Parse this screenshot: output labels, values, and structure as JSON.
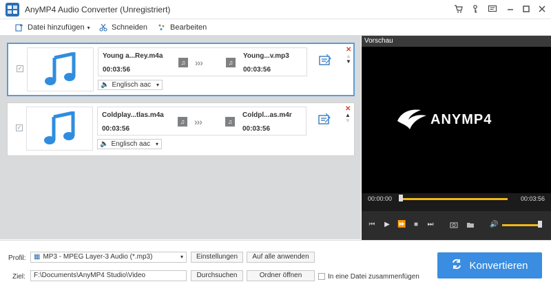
{
  "titlebar": {
    "title": "AnyMP4 Audio Converter (Unregistriert)",
    "buttons": [
      "cart-icon",
      "key-icon",
      "feedback-icon",
      "minimize-icon",
      "maximize-icon",
      "close-icon"
    ]
  },
  "toolbar": {
    "add_file_label": "Datei hinzufügen",
    "cut_label": "Schneiden",
    "edit_label": "Bearbeiten"
  },
  "files": [
    {
      "source_name": "Young a...Rey.m4a",
      "source_duration": "00:03:56",
      "target_name": "Young...v.mp3",
      "target_duration": "00:03:56",
      "audio_track": "Englisch aac",
      "checked": true,
      "selected": true
    },
    {
      "source_name": "Coldplay...tlas.m4a",
      "source_duration": "00:03:56",
      "target_name": "Coldpl...as.m4r",
      "target_duration": "00:03:56",
      "audio_track": "Englisch aac",
      "checked": true,
      "selected": false
    }
  ],
  "preview": {
    "title": "Vorschau",
    "brand": "ANYMP4",
    "time_current": "00:00:00",
    "time_total": "00:03:56",
    "progress": 0.0,
    "volume": 0.9
  },
  "bottom": {
    "profile_label": "Profil:",
    "profile_value": "MP3 - MPEG Layer-3 Audio (*.mp3)",
    "settings_button": "Einstellungen",
    "apply_all_button": "Auf alle anwenden",
    "target_label": "Ziel:",
    "target_path": "F:\\Documents\\AnyMP4 Studio\\Video",
    "browse_button": "Durchsuchen",
    "open_folder_button": "Ordner öffnen",
    "merge_label": "In eine Datei zusammenfügen",
    "convert_button": "Konvertieren"
  },
  "colors": {
    "accent": "#3a8de0",
    "selection": "#5b9bd5",
    "seek": "#f4b816",
    "list_bg": "#d9dadc"
  }
}
